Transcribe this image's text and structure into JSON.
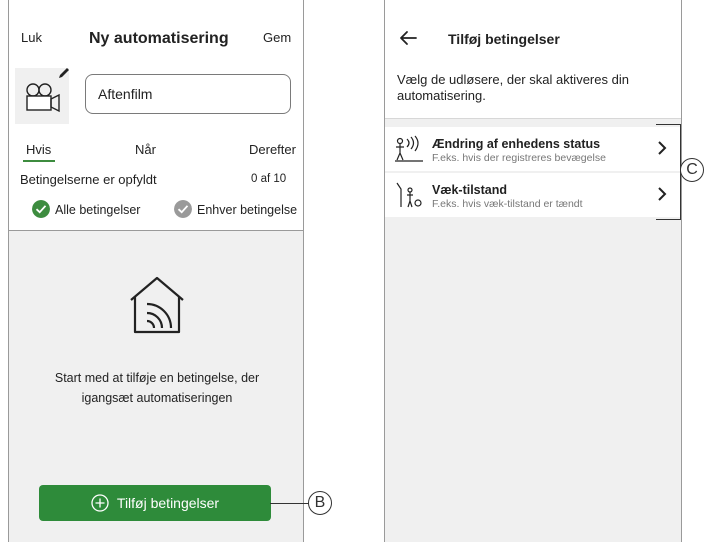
{
  "left_screen": {
    "header": {
      "close_label": "Luk",
      "title": "Ny automatisering",
      "save_label": "Gem"
    },
    "name_field": {
      "value": "Aftenfilm"
    },
    "tabs": [
      {
        "label": "Hvis",
        "active": true
      },
      {
        "label": "Når",
        "active": false
      },
      {
        "label": "Derefter",
        "active": false
      }
    ],
    "conditions_met_label": "Betingelserne er opfyldt",
    "conditions_count": "0 af 10",
    "options": {
      "all": {
        "label": "Alle betingelser",
        "selected": true
      },
      "any": {
        "label": "Enhver betingelse",
        "selected": false
      }
    },
    "empty_message": {
      "line1": "Start med at tilføje en betingelse, der",
      "line2": "igangsæt automatiseringen"
    },
    "add_button_label": "Tilføj betingelser",
    "callout_label": "B"
  },
  "right_screen": {
    "header": {
      "title": "Tilføj betingelser"
    },
    "description": "Vælg de udløsere, der skal aktiveres din automatisering.",
    "conditions": [
      {
        "icon": "motion-sensor-icon",
        "title": "Ændring af enhedens status",
        "subtitle": "F.eks. hvis der registreres bevægelse"
      },
      {
        "icon": "person-away-icon",
        "title": "Væk-tilstand",
        "subtitle": "F.eks. hvis væk-tilstand er tændt"
      }
    ],
    "callout_label": "C"
  },
  "colors": {
    "accent_green": "#2e8b3a",
    "checked_green": "#3d8c3f",
    "unchecked_gray": "#9a9a9a",
    "muted_bg": "#f0f0f0"
  }
}
